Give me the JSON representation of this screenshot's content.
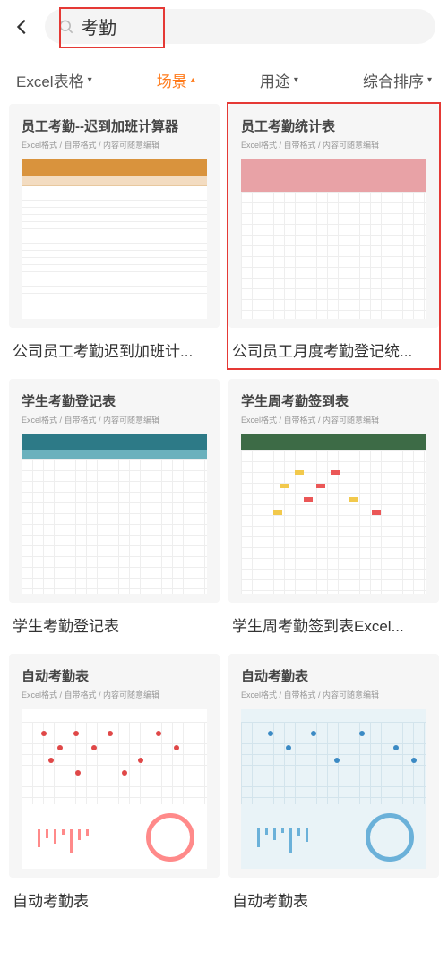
{
  "search": {
    "value": "考勤"
  },
  "filters": [
    {
      "label": "Excel表格",
      "active": false
    },
    {
      "label": "场景",
      "active": true
    },
    {
      "label": "用途",
      "active": false
    },
    {
      "label": "综合排序",
      "active": false
    }
  ],
  "thumb_subtitle": "Excel格式 / 自带格式 / 内容可随意编辑",
  "cards": [
    {
      "thumb_title": "员工考勤--迟到加班计算器",
      "caption": "公司员工考勤迟到加班计..."
    },
    {
      "thumb_title": "员工考勤统计表",
      "caption": "公司员工月度考勤登记统...",
      "selected": true
    },
    {
      "thumb_title": "学生考勤登记表",
      "caption": "学生考勤登记表"
    },
    {
      "thumb_title": "学生周考勤签到表",
      "caption": "学生周考勤签到表Excel..."
    },
    {
      "thumb_title": "自动考勤表",
      "caption": "自动考勤表"
    },
    {
      "thumb_title": "自动考勤表",
      "caption": "自动考勤表"
    }
  ]
}
